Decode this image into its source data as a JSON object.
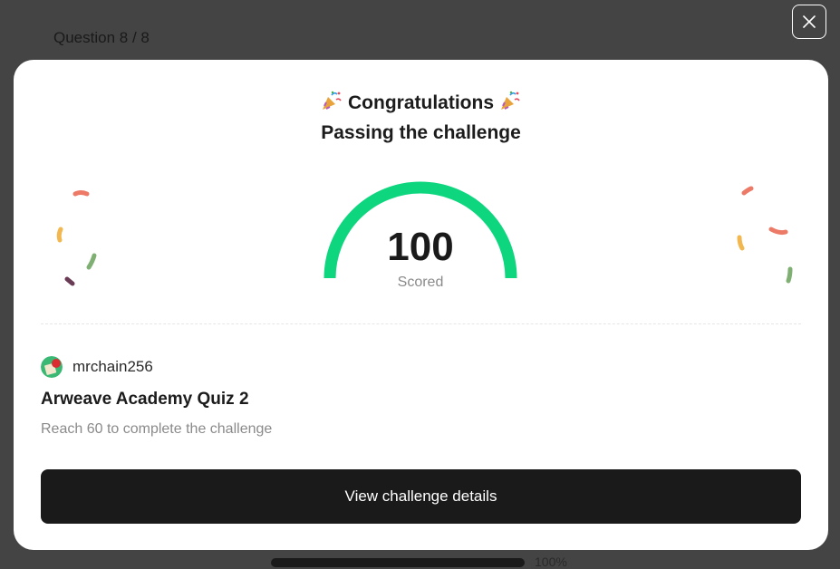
{
  "background": {
    "question_counter": "Question 8 / 8",
    "progress_label": "100%",
    "progress_value": 1.0
  },
  "close_button": {
    "icon": "close-icon"
  },
  "modal": {
    "title": "Congratulations",
    "title_icon": "party-popper-icon",
    "subtitle": "Passing the challenge",
    "score": {
      "value": "100",
      "label": "Scored",
      "fraction": 1.0,
      "color": "#0ed67f"
    },
    "user": {
      "name": "mrchain256",
      "avatar_icon": "user-avatar-icon"
    },
    "quiz_title": "Arweave Academy Quiz 2",
    "requirement": "Reach 60 to complete the challenge",
    "button_label": "View challenge details"
  },
  "colors": {
    "overlay": "#444444",
    "modal_bg": "#ffffff",
    "button_bg": "#1a1a1a",
    "accent": "#0ed67f"
  }
}
